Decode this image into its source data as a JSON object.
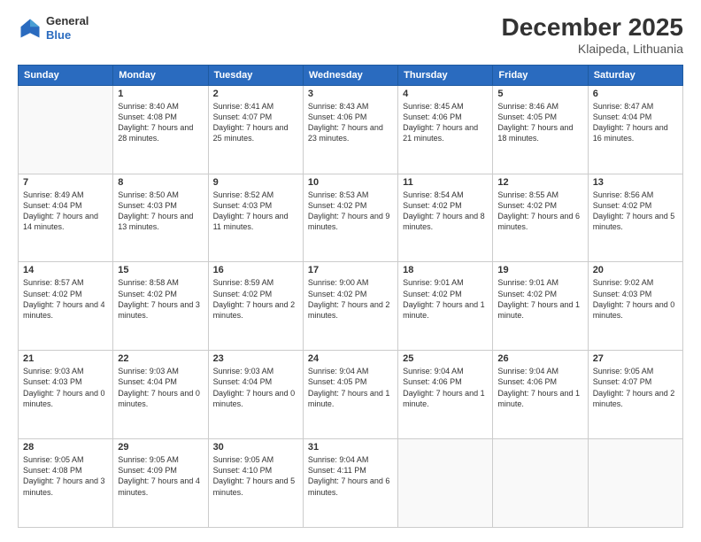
{
  "header": {
    "logo_general": "General",
    "logo_blue": "Blue",
    "title": "December 2025",
    "subtitle": "Klaipeda, Lithuania"
  },
  "days_of_week": [
    "Sunday",
    "Monday",
    "Tuesday",
    "Wednesday",
    "Thursday",
    "Friday",
    "Saturday"
  ],
  "weeks": [
    [
      {
        "num": "",
        "sunrise": "",
        "sunset": "",
        "daylight": "",
        "empty": true
      },
      {
        "num": "1",
        "sunrise": "Sunrise: 8:40 AM",
        "sunset": "Sunset: 4:08 PM",
        "daylight": "Daylight: 7 hours and 28 minutes."
      },
      {
        "num": "2",
        "sunrise": "Sunrise: 8:41 AM",
        "sunset": "Sunset: 4:07 PM",
        "daylight": "Daylight: 7 hours and 25 minutes."
      },
      {
        "num": "3",
        "sunrise": "Sunrise: 8:43 AM",
        "sunset": "Sunset: 4:06 PM",
        "daylight": "Daylight: 7 hours and 23 minutes."
      },
      {
        "num": "4",
        "sunrise": "Sunrise: 8:45 AM",
        "sunset": "Sunset: 4:06 PM",
        "daylight": "Daylight: 7 hours and 21 minutes."
      },
      {
        "num": "5",
        "sunrise": "Sunrise: 8:46 AM",
        "sunset": "Sunset: 4:05 PM",
        "daylight": "Daylight: 7 hours and 18 minutes."
      },
      {
        "num": "6",
        "sunrise": "Sunrise: 8:47 AM",
        "sunset": "Sunset: 4:04 PM",
        "daylight": "Daylight: 7 hours and 16 minutes."
      }
    ],
    [
      {
        "num": "7",
        "sunrise": "Sunrise: 8:49 AM",
        "sunset": "Sunset: 4:04 PM",
        "daylight": "Daylight: 7 hours and 14 minutes."
      },
      {
        "num": "8",
        "sunrise": "Sunrise: 8:50 AM",
        "sunset": "Sunset: 4:03 PM",
        "daylight": "Daylight: 7 hours and 13 minutes."
      },
      {
        "num": "9",
        "sunrise": "Sunrise: 8:52 AM",
        "sunset": "Sunset: 4:03 PM",
        "daylight": "Daylight: 7 hours and 11 minutes."
      },
      {
        "num": "10",
        "sunrise": "Sunrise: 8:53 AM",
        "sunset": "Sunset: 4:02 PM",
        "daylight": "Daylight: 7 hours and 9 minutes."
      },
      {
        "num": "11",
        "sunrise": "Sunrise: 8:54 AM",
        "sunset": "Sunset: 4:02 PM",
        "daylight": "Daylight: 7 hours and 8 minutes."
      },
      {
        "num": "12",
        "sunrise": "Sunrise: 8:55 AM",
        "sunset": "Sunset: 4:02 PM",
        "daylight": "Daylight: 7 hours and 6 minutes."
      },
      {
        "num": "13",
        "sunrise": "Sunrise: 8:56 AM",
        "sunset": "Sunset: 4:02 PM",
        "daylight": "Daylight: 7 hours and 5 minutes."
      }
    ],
    [
      {
        "num": "14",
        "sunrise": "Sunrise: 8:57 AM",
        "sunset": "Sunset: 4:02 PM",
        "daylight": "Daylight: 7 hours and 4 minutes."
      },
      {
        "num": "15",
        "sunrise": "Sunrise: 8:58 AM",
        "sunset": "Sunset: 4:02 PM",
        "daylight": "Daylight: 7 hours and 3 minutes."
      },
      {
        "num": "16",
        "sunrise": "Sunrise: 8:59 AM",
        "sunset": "Sunset: 4:02 PM",
        "daylight": "Daylight: 7 hours and 2 minutes."
      },
      {
        "num": "17",
        "sunrise": "Sunrise: 9:00 AM",
        "sunset": "Sunset: 4:02 PM",
        "daylight": "Daylight: 7 hours and 2 minutes."
      },
      {
        "num": "18",
        "sunrise": "Sunrise: 9:01 AM",
        "sunset": "Sunset: 4:02 PM",
        "daylight": "Daylight: 7 hours and 1 minute."
      },
      {
        "num": "19",
        "sunrise": "Sunrise: 9:01 AM",
        "sunset": "Sunset: 4:02 PM",
        "daylight": "Daylight: 7 hours and 1 minute."
      },
      {
        "num": "20",
        "sunrise": "Sunrise: 9:02 AM",
        "sunset": "Sunset: 4:03 PM",
        "daylight": "Daylight: 7 hours and 0 minutes."
      }
    ],
    [
      {
        "num": "21",
        "sunrise": "Sunrise: 9:03 AM",
        "sunset": "Sunset: 4:03 PM",
        "daylight": "Daylight: 7 hours and 0 minutes."
      },
      {
        "num": "22",
        "sunrise": "Sunrise: 9:03 AM",
        "sunset": "Sunset: 4:04 PM",
        "daylight": "Daylight: 7 hours and 0 minutes."
      },
      {
        "num": "23",
        "sunrise": "Sunrise: 9:03 AM",
        "sunset": "Sunset: 4:04 PM",
        "daylight": "Daylight: 7 hours and 0 minutes."
      },
      {
        "num": "24",
        "sunrise": "Sunrise: 9:04 AM",
        "sunset": "Sunset: 4:05 PM",
        "daylight": "Daylight: 7 hours and 1 minute."
      },
      {
        "num": "25",
        "sunrise": "Sunrise: 9:04 AM",
        "sunset": "Sunset: 4:06 PM",
        "daylight": "Daylight: 7 hours and 1 minute."
      },
      {
        "num": "26",
        "sunrise": "Sunrise: 9:04 AM",
        "sunset": "Sunset: 4:06 PM",
        "daylight": "Daylight: 7 hours and 1 minute."
      },
      {
        "num": "27",
        "sunrise": "Sunrise: 9:05 AM",
        "sunset": "Sunset: 4:07 PM",
        "daylight": "Daylight: 7 hours and 2 minutes."
      }
    ],
    [
      {
        "num": "28",
        "sunrise": "Sunrise: 9:05 AM",
        "sunset": "Sunset: 4:08 PM",
        "daylight": "Daylight: 7 hours and 3 minutes."
      },
      {
        "num": "29",
        "sunrise": "Sunrise: 9:05 AM",
        "sunset": "Sunset: 4:09 PM",
        "daylight": "Daylight: 7 hours and 4 minutes."
      },
      {
        "num": "30",
        "sunrise": "Sunrise: 9:05 AM",
        "sunset": "Sunset: 4:10 PM",
        "daylight": "Daylight: 7 hours and 5 minutes."
      },
      {
        "num": "31",
        "sunrise": "Sunrise: 9:04 AM",
        "sunset": "Sunset: 4:11 PM",
        "daylight": "Daylight: 7 hours and 6 minutes."
      },
      {
        "num": "",
        "sunrise": "",
        "sunset": "",
        "daylight": "",
        "empty": true
      },
      {
        "num": "",
        "sunrise": "",
        "sunset": "",
        "daylight": "",
        "empty": true
      },
      {
        "num": "",
        "sunrise": "",
        "sunset": "",
        "daylight": "",
        "empty": true
      }
    ]
  ]
}
